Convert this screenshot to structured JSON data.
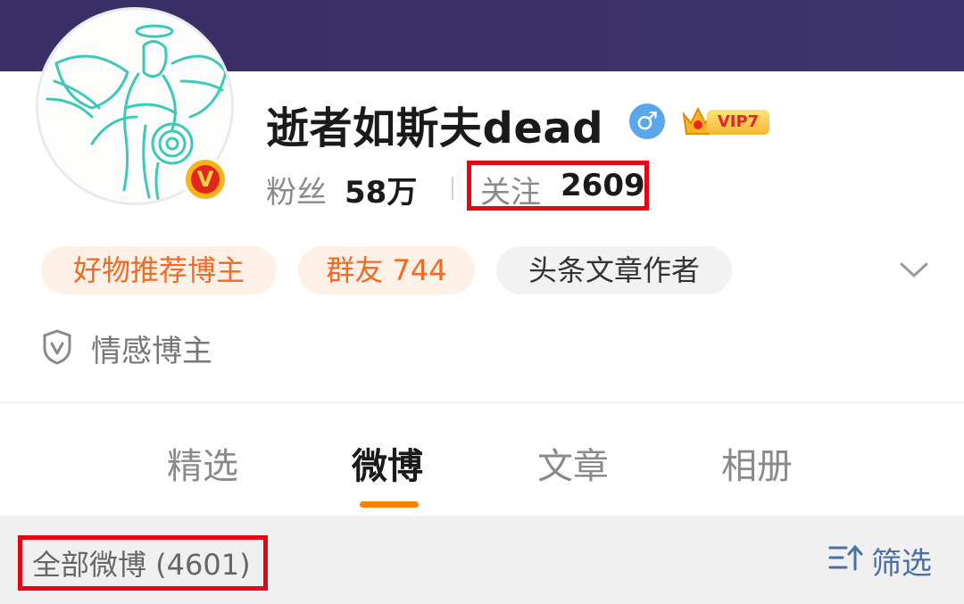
{
  "profile": {
    "username": "逝者如斯夫dead",
    "gender_symbol": "♂",
    "verified_badge": "V",
    "vip_label": "VIP7",
    "avatar_icon": "angel-line-drawing"
  },
  "stats": {
    "fans_label": "粉丝",
    "fans_value": "58万",
    "following_label": "关注",
    "following_value": "2609"
  },
  "tags": [
    {
      "label": "好物推荐博主",
      "style": "orange"
    },
    {
      "label": "群友 744",
      "style": "orange"
    },
    {
      "label": "头条文章作者",
      "style": "gray"
    }
  ],
  "emotion": {
    "label": "情感博主",
    "icon": "shield-v-icon"
  },
  "tabs": [
    {
      "label": "精选",
      "active": false
    },
    {
      "label": "微博",
      "active": true
    },
    {
      "label": "文章",
      "active": false
    },
    {
      "label": "相册",
      "active": false
    }
  ],
  "list": {
    "all_count": "全部微博 (4601)",
    "filter_label": "筛选"
  },
  "colors": {
    "banner": "#3a2f66",
    "accent_orange": "#ff8200",
    "highlight_red": "#e30613",
    "filter_blue": "#4a6fa5"
  }
}
